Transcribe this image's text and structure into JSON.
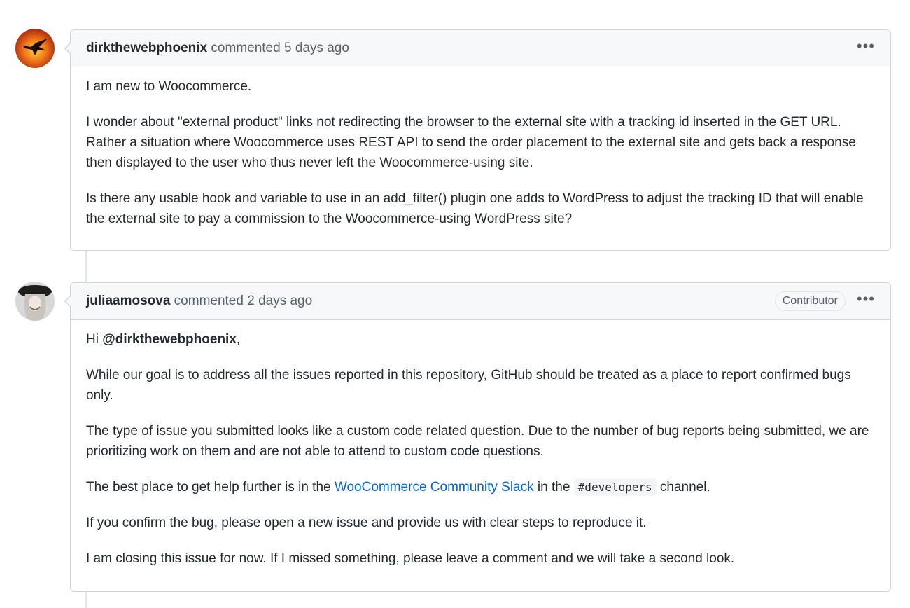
{
  "comments": [
    {
      "author": "dirkthewebphoenix",
      "action": "commented",
      "time": "5 days ago",
      "menu_label": "•••",
      "paragraphs": [
        "I am new to Woocommerce.",
        "I wonder about \"external product\" links not redirecting the browser to the external site with a tracking id inserted in the GET URL. Rather a situation where Woocommerce uses REST API to send the order placement to the external site and gets back a response then displayed to the user who thus never left the Woocommerce-using site.",
        "Is there any usable hook and variable to use in an add_filter() plugin one adds to WordPress to adjust the tracking ID that will enable the external site to pay a commission to the Woocommerce-using WordPress site?"
      ]
    },
    {
      "author": "juliaamosova",
      "action": "commented",
      "time": "2 days ago",
      "badge": "Contributor",
      "menu_label": "•••",
      "greeting_prefix": "Hi ",
      "greeting_mention": "@dirkthewebphoenix",
      "greeting_suffix": ",",
      "p1": "While our goal is to address all the issues reported in this repository, GitHub should be treated as a place to report confirmed bugs only.",
      "p2": "The type of issue you submitted looks like a custom code related question. Due to the number of bug reports being submitted, we are prioritizing work on them and are not able to attend to custom code questions.",
      "p3_prefix": "The best place to get help further is in the ",
      "p3_link": "WooCommerce Community Slack",
      "p3_middle": " in the ",
      "p3_code": "#developers",
      "p3_suffix": " channel.",
      "p4": "If you confirm the bug, please open a new issue and provide us with clear steps to reproduce it.",
      "p5": "I am closing this issue for now. If I missed something, please leave a comment and we will take a second look."
    }
  ],
  "colors": {
    "link": "#0366d6",
    "header_bg": "#f6f8fa",
    "border": "#d1d5da"
  },
  "icons": {
    "avatar_1": "phoenix-avatar",
    "avatar_2": "user-photo-avatar"
  }
}
